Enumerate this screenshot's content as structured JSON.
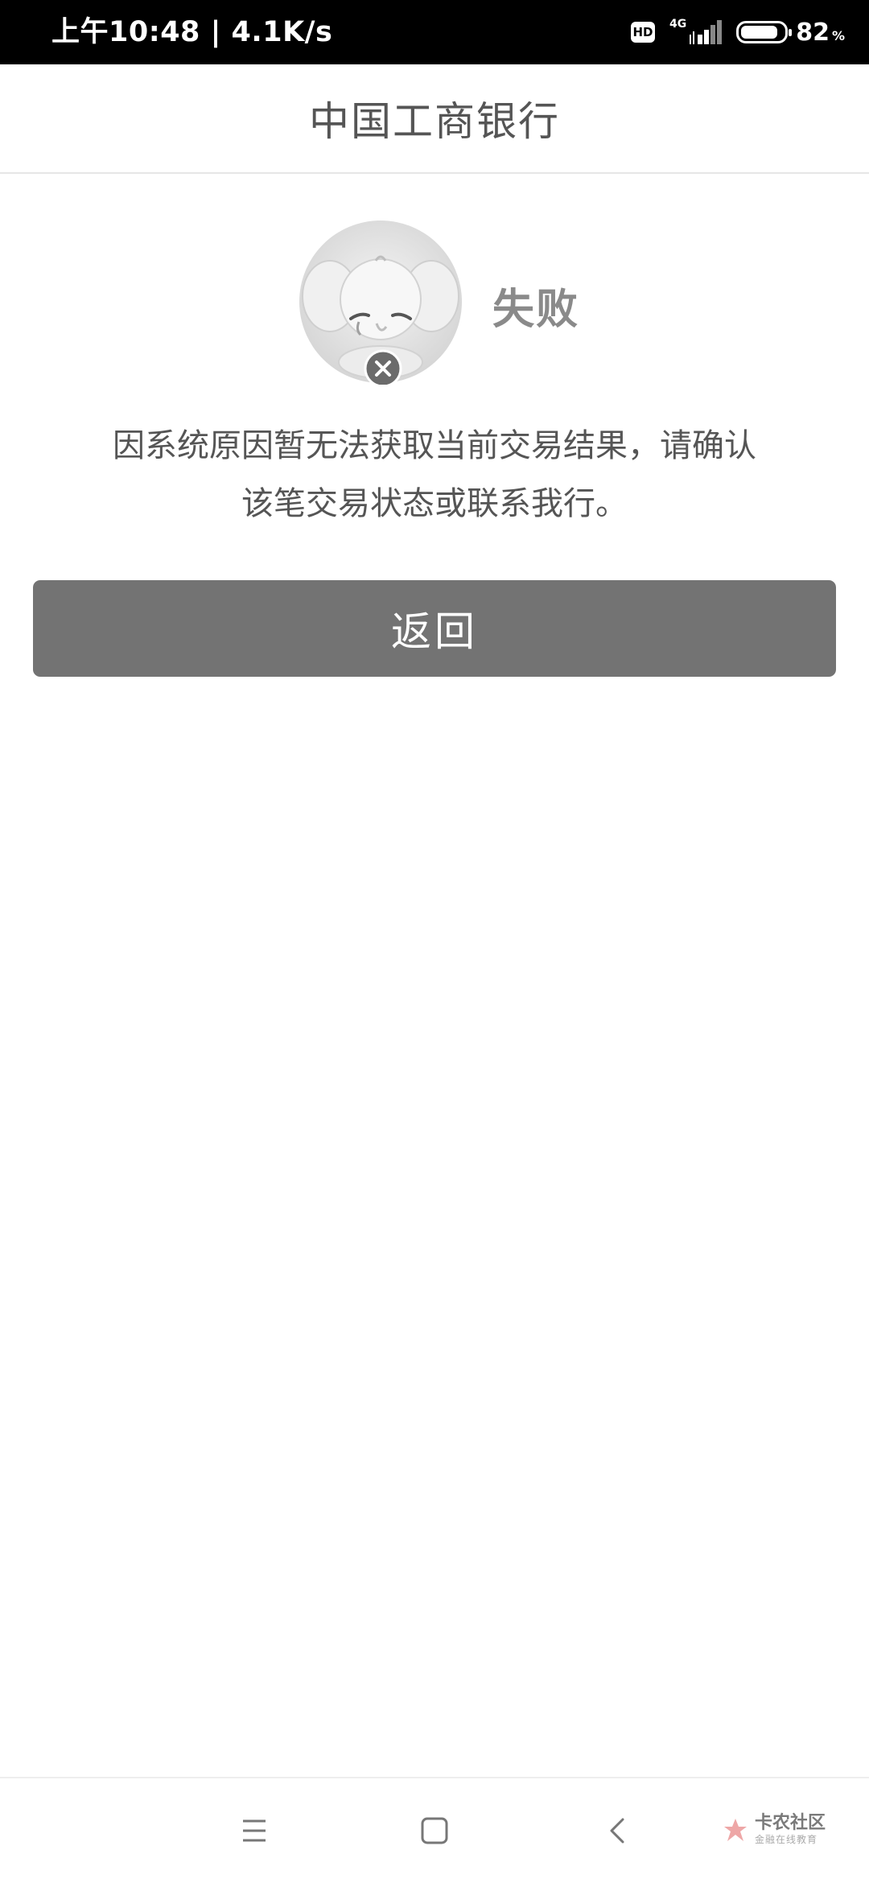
{
  "status_bar": {
    "time_speed": "上午10:48 | 4.1K/s",
    "hd": "HD",
    "network": "4G",
    "battery_percent": "82",
    "battery_unit": "%"
  },
  "header": {
    "title": "中国工商银行"
  },
  "result": {
    "status": "失败",
    "message_line1": "因系统原因暂无法获取当前交易结果，请确认",
    "message_line2": "该笔交易状态或联系我行。"
  },
  "actions": {
    "back_label": "返回"
  },
  "nav": {
    "icons": [
      "menu-icon",
      "home-icon",
      "back-icon"
    ]
  },
  "watermark": {
    "title": "卡农社区",
    "subtitle": "金融在线教育"
  },
  "colors": {
    "status_bar_bg": "#000000",
    "button_bg": "#737373",
    "title_text": "#555555",
    "status_text": "#8a8a8a"
  }
}
